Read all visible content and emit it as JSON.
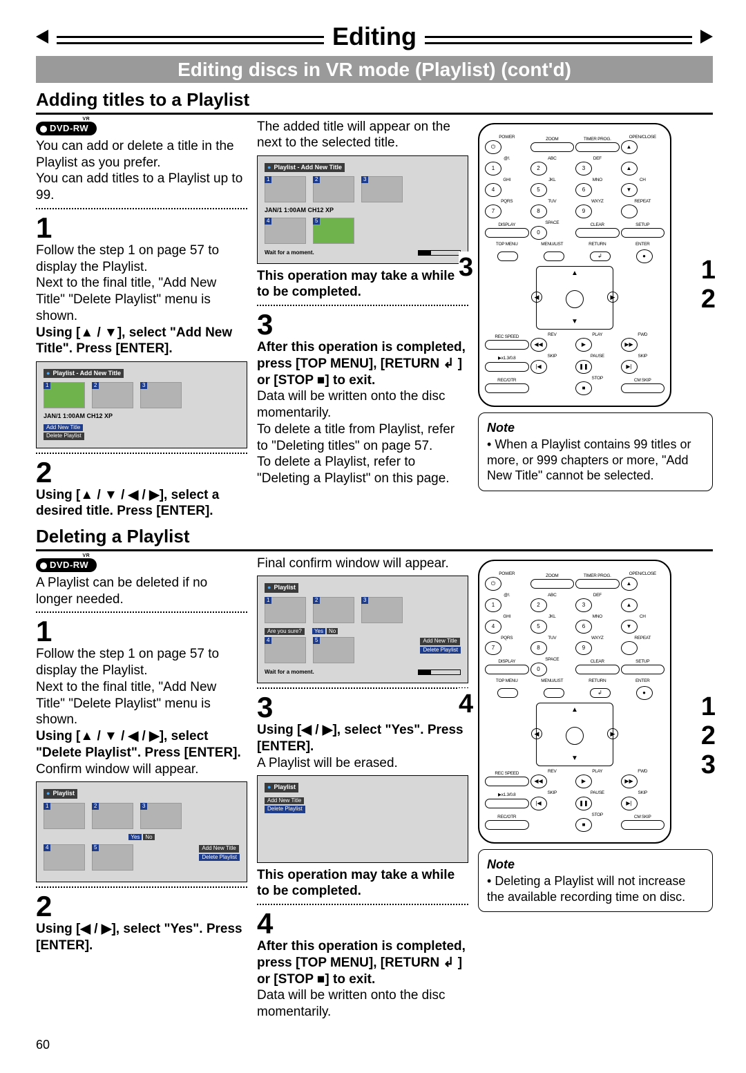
{
  "header": {
    "top_title": "Editing",
    "sub_banner": "Editing discs in VR mode (Playlist) (cont'd)"
  },
  "section1": {
    "title": "Adding titles to a Playlist",
    "badge": "DVD-RW",
    "intro1": "You can add or delete a title in the Playlist as you prefer.",
    "intro2": "You can add titles to a Playlist up to 99.",
    "step1_num": "1",
    "step1_a": "Follow the step 1 on page 57 to display the Playlist.",
    "step1_b": "Next to the final title, \"Add New Title\" \"Delete Playlist\" menu is shown.",
    "step1_c": "Using [▲ / ▼], select \"Add New Title\". Press [ENTER].",
    "screen1_hdr": "Playlist - Add New Title",
    "screen1_caption": "JAN/1 1:00AM CH12 XP",
    "screen1_menu_a": "Add New Title",
    "screen1_menu_b": "Delete Playlist",
    "step2_num": "2",
    "step2_a": "Using [▲ / ▼ / ◀ / ▶], select a desired title. Press [ENTER].",
    "col2_intro": "The added title will appear on the next to the selected title.",
    "screen2_hdr": "Playlist - Add New Title",
    "screen2_caption": "JAN/1 1:00AM CH12 XP",
    "screen2_wait": "Wait for a moment.",
    "col2_warn": "This operation may take a while to be completed.",
    "step3_num": "3",
    "step3_a": "After this operation is completed, press [TOP MENU], [RETURN ↲ ] or [STOP ■] to exit.",
    "step3_b": "Data will be written onto the disc momentarily.",
    "step3_c": "To delete a title from Playlist, refer to \"Deleting titles\" on page 57.",
    "step3_d": "To delete a Playlist, refer to \"Deleting a Playlist\" on this page.",
    "note_title": "Note",
    "note_body": "When a Playlist contains 99 titles or more, or 999 chapters or more, \"Add New Title\" cannot be selected.",
    "callouts": {
      "c3": "3",
      "c1": "1",
      "c2": "2"
    }
  },
  "section2": {
    "title": "Deleting a Playlist",
    "badge": "DVD-RW",
    "intro": "A Playlist can be deleted if no longer needed.",
    "step1_num": "1",
    "step1_a": "Follow the step 1 on page 57 to display the Playlist.",
    "step1_b": "Next to the final title, \"Add New Title\" \"Delete Playlist\" menu is shown.",
    "step1_c": "Using [▲ / ▼ / ◀ / ▶], select \"Delete Playlist\". Press [ENTER].",
    "step1_d": "Confirm window will appear.",
    "screen1_hdr": "Playlist",
    "screen1_yes": "Yes",
    "screen1_no": "No",
    "screen1_menu_a": "Add New Title",
    "screen1_menu_b": "Delete Playlist",
    "step2_num": "2",
    "step2_a": "Using [◀ / ▶], select \"Yes\". Press [ENTER].",
    "col2_intro": "Final confirm window will appear.",
    "screen2_hdr": "Playlist",
    "screen2_confirm": "Are you sure?",
    "screen2_yes": "Yes",
    "screen2_no": "No",
    "screen2_menu_a": "Add New Title",
    "screen2_menu_b": "Delete Playlist",
    "screen2_wait": "Wait for a moment.",
    "step3_num": "3",
    "step3_a": "Using [◀ / ▶], select \"Yes\". Press [ENTER].",
    "step3_b": "A Playlist will be erased.",
    "screen3_hdr": "Playlist",
    "screen3_menu_a": "Add New Title",
    "screen3_menu_b": "Delete Playlist",
    "col2_warn": "This operation may take a while to be completed.",
    "step4_num": "4",
    "step4_a": "After this operation is completed, press [TOP MENU], [RETURN ↲ ] or [STOP ■] to exit.",
    "step4_b": "Data will be written onto the disc momentarily.",
    "note_title": "Note",
    "note_body": "Deleting a Playlist will not increase the available recording time on disc.",
    "callouts": {
      "c4": "4",
      "c1": "1",
      "c2": "2",
      "c3": "3"
    }
  },
  "remote": {
    "power": "POWER",
    "open": "OPEN/CLOSE",
    "zoom": "ZOOM",
    "timer": "TIMER PROG.",
    "abc": "ABC",
    "def": "DEF",
    "ghi": "GHI",
    "jkl": "JKL",
    "mno": "MNO",
    "ch": "CH",
    "pqrs": "PQRS",
    "tuv": "TUV",
    "wxyz": "WXYZ",
    "repeat": "REPEAT",
    "display": "DISPLAY",
    "space": "SPACE",
    "clear": "CLEAR",
    "setup": "SETUP",
    "topmenu": "TOP MENU",
    "menulist": "MENU/LIST",
    "return": "RETURN",
    "enter": "ENTER",
    "recspeed": "REC SPEED",
    "rev": "REV",
    "play": "PLAY",
    "fwd": "FWD",
    "x13": "▶x1.3/0.8",
    "skip": "SKIP",
    "pause": "PAUSE",
    "recotr": "REC/OTR",
    "stop": "STOP",
    "cmskip": "CM SKIP",
    "sym_at": "@!.",
    "n1": "1",
    "n2": "2",
    "n3": "3",
    "n4": "4",
    "n5": "5",
    "n6": "6",
    "n7": "7",
    "n8": "8",
    "n9": "9",
    "n0": "0"
  },
  "page_number": "60"
}
